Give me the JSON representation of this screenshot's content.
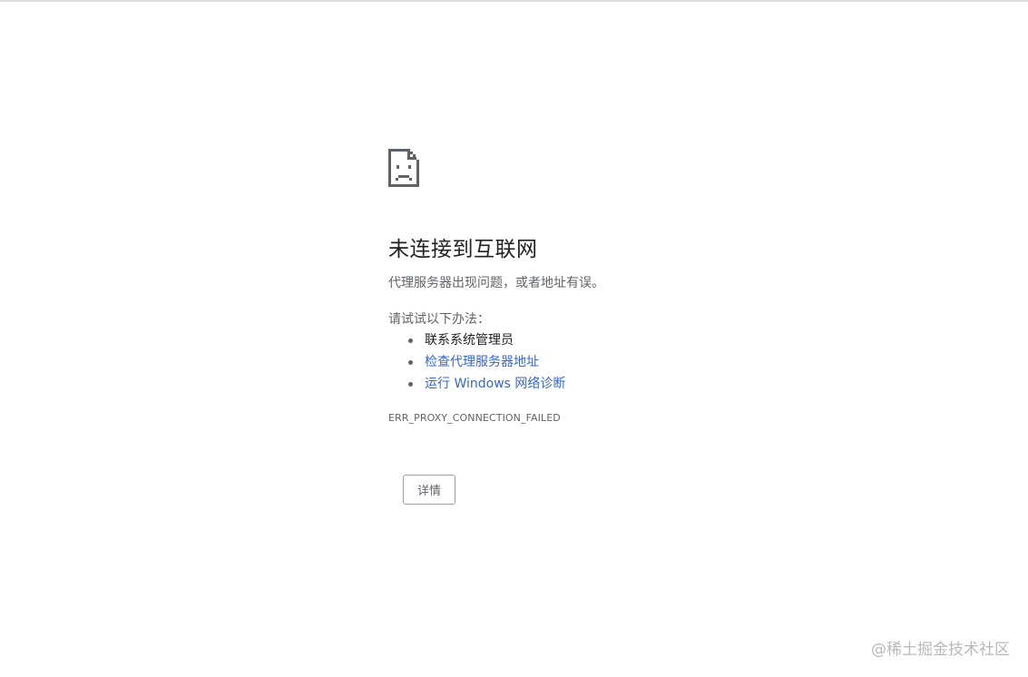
{
  "page": {
    "title": "未连接到互联网",
    "subtitle": "代理服务器出现问题，或者地址有误。",
    "try_label": "请试试以下办法：",
    "suggestions": [
      {
        "label": "联系系统管理员",
        "is_link": false
      },
      {
        "label": "检查代理服务器地址",
        "is_link": true
      },
      {
        "label": "运行 Windows 网络诊断",
        "is_link": true
      }
    ],
    "error_code": "ERR_PROXY_CONNECTION_FAILED",
    "details_button": "详情"
  },
  "icons": {
    "error_icon": "sad-page-icon"
  },
  "watermark": "@稀土掘金技术社区",
  "colors": {
    "title": "#202124",
    "body_text": "#5f6368",
    "link": "#3367d6",
    "icon": "#5f6368"
  }
}
